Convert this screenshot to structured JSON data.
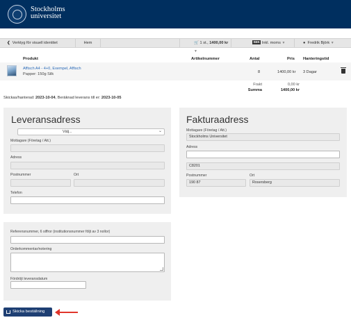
{
  "header": {
    "logo_line1": "Stockholms",
    "logo_line2": "universitet"
  },
  "toolbar": {
    "back_icon": "chevron-left-icon",
    "accessibility_label": "Verktyg för visuell identitet",
    "home_label": "Hem",
    "cart_count": "1 st.,",
    "cart_total": "1400,00 kr",
    "sek_badge": "SEK",
    "vat_label": "Inkl. moms",
    "user_name": "Fredrik Björk",
    "dropdown_caret": "▼"
  },
  "order_table": {
    "headers": {
      "product": "Produkt",
      "article": "Artikelnummer",
      "qty": "Antal",
      "price": "Pris",
      "handling": "Hanteringstid"
    },
    "rows": [
      {
        "title": "Affisch A4 - 4+0, Exempel, Affisch",
        "subtitle": "Papper: 150g Silk",
        "article": "",
        "qty": "8",
        "price": "1400,00 kr",
        "handling": "3 Dagar"
      }
    ],
    "freight_label": "Frakt",
    "freight_value": "0,00 kr",
    "sum_label": "Summa",
    "sum_value": "1400,00 kr"
  },
  "shipping_info": {
    "prefix": "Skickas/hanterad:",
    "handled_date": "2023-10-04",
    "middle": ", Beräknad leverans till er:",
    "delivery_date": "2023-10-05"
  },
  "delivery": {
    "title": "Leveransadress",
    "select_value": "Välj...",
    "recipient_label": "Mottagare (Företag / Att.)",
    "address_label": "Adress",
    "postal_label": "Postnummer",
    "city_label": "Ort",
    "phone_label": "Telefon"
  },
  "invoice": {
    "title": "Fakturaadress",
    "recipient_label": "Mottagare (Företag / Att.)",
    "recipient_value": "Stockholms Universitet",
    "address_label": "Adress",
    "address_value": "",
    "address_line2": "C8201",
    "postal_label": "Postnummer",
    "postal_value": "190 87",
    "city_label": "Ort",
    "city_value": "Rosersberg"
  },
  "extra": {
    "reference_label": "Referensnummer, 6 siffror (institutionsnummer följt av 3 nollor)",
    "comment_label": "Orderkommentar/notering",
    "delayed_label": "Fördröjt leveransdatum"
  },
  "submit": {
    "label": "Skicka beställning",
    "icon": "send-icon"
  },
  "colors": {
    "header_bg": "#002f5f",
    "button_bg": "#1e3f73",
    "link": "#2a6ab8",
    "arrow": "#e0352b"
  }
}
